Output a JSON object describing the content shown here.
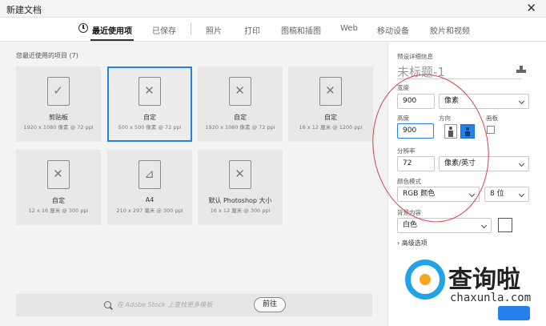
{
  "window": {
    "title": "新建文档",
    "close_glyph": "✕"
  },
  "tabs": [
    {
      "label": "最近使用项",
      "active": true,
      "icon": "clock-icon"
    },
    {
      "label": "已保存"
    },
    {
      "label": "照片"
    },
    {
      "label": "打印"
    },
    {
      "label": "图稿和插图"
    },
    {
      "label": "Web"
    },
    {
      "label": "移动设备"
    },
    {
      "label": "胶片和视频"
    }
  ],
  "recent": {
    "heading": "您最近使用的项目",
    "count": "(7)",
    "items": [
      {
        "name": "剪贴板",
        "spec": "1920 x 1080 像素 @ 72 ppi",
        "icon": "clipboard-doc-icon",
        "glyph": "✓"
      },
      {
        "name": "自定",
        "spec": "500 x 500 像素 @ 72 ppi",
        "icon": "custom-doc-icon",
        "glyph": "✕",
        "selected": true
      },
      {
        "name": "自定",
        "spec": "1920 x 1080 像素 @ 72 ppi",
        "icon": "custom-doc-icon",
        "glyph": "✕"
      },
      {
        "name": "自定",
        "spec": "16 x 12 厘米 @ 1200 ppi",
        "icon": "custom-doc-icon",
        "glyph": "✕"
      },
      {
        "name": "自定",
        "spec": "12 x 16 厘米 @ 300 ppi",
        "icon": "custom-doc-icon",
        "glyph": "✕"
      },
      {
        "name": "A4",
        "spec": "210 x 297 毫米 @ 300 ppi",
        "icon": "a4-doc-icon",
        "glyph": "⊿"
      },
      {
        "name": "默认 Photoshop 大小",
        "spec": "16 x 12 厘米 @ 300 ppi",
        "icon": "custom-doc-icon",
        "glyph": "✕"
      }
    ]
  },
  "stock": {
    "placeholder": "在 Adobe Stock 上查找更多模板",
    "go_label": "前往",
    "icon": "search-icon"
  },
  "preset": {
    "heading": "预设详细信息",
    "doc_title": "未标题-1",
    "save_icon": "save-preset-icon",
    "width_label": "宽度",
    "width_value": "900",
    "width_unit": "像素",
    "height_label": "高度",
    "height_value": "900",
    "orientation_label": "方向",
    "artboard_label": "画板",
    "resolution_label": "分辨率",
    "resolution_value": "72",
    "resolution_unit": "像素/英寸",
    "color_mode_label": "颜色模式",
    "color_mode_value": "RGB 颜色",
    "bit_depth": "8 位",
    "background_label": "背景内容",
    "background_value": "白色",
    "advanced_label": "高级选项",
    "advanced_glyph": "›"
  },
  "watermark": {
    "name": "查询啦",
    "domain": "chaxunla.com"
  },
  "colors": {
    "accent": "#2680eb",
    "annotation": "#d9414a",
    "watermark_blue": "#22a3e8",
    "watermark_orange": "#f5a623"
  }
}
